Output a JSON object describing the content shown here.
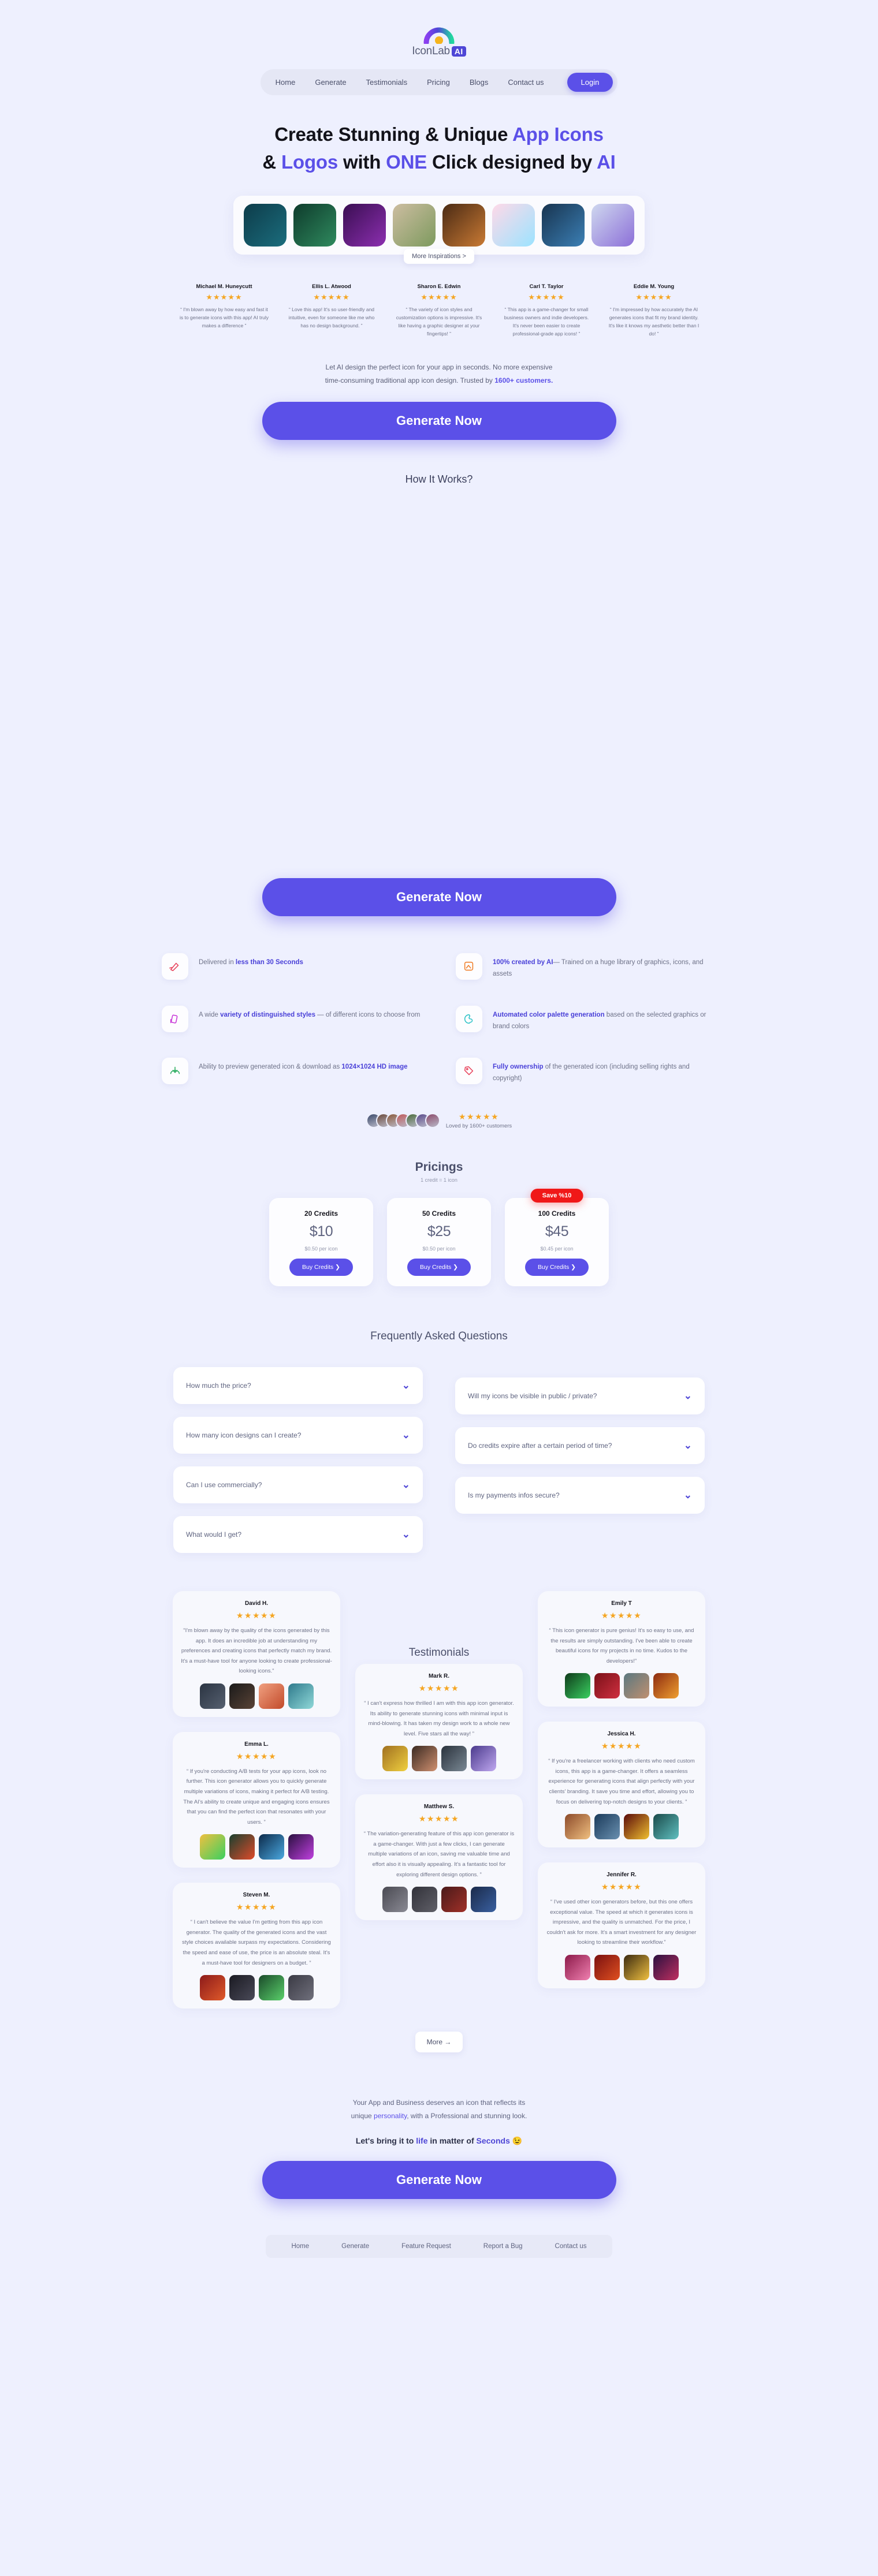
{
  "brand": {
    "name": "IconLab",
    "badge": "AI"
  },
  "nav": {
    "items": [
      {
        "label": "Home"
      },
      {
        "label": "Generate"
      },
      {
        "label": "Testimonials"
      },
      {
        "label": "Pricing"
      },
      {
        "label": "Blogs"
      },
      {
        "label": "Contact us"
      }
    ],
    "login": "Login"
  },
  "hero": {
    "line1_a": "Create Stunning & Unique ",
    "line1_b": "App Icons",
    "line2_a": "& ",
    "line2_b": "Logos",
    "line2_c": " with ",
    "line2_d": "ONE",
    "line2_e": " Click designed by ",
    "line2_f": "AI"
  },
  "strip": {
    "more_label": "More Inspirations >",
    "tiles": [
      {
        "name": "robot-icon",
        "c1": "#0d3c4a",
        "c2": "#1b6d7d"
      },
      {
        "name": "mushroom-icon",
        "c1": "#0e3b2c",
        "c2": "#2f8a5e"
      },
      {
        "name": "panther-icon",
        "c1": "#3a0e52",
        "c2": "#8c2fb0"
      },
      {
        "name": "tree-icon",
        "c1": "#cdbda1",
        "c2": "#7d9a5e"
      },
      {
        "name": "warrior-icon",
        "c1": "#4a2a14",
        "c2": "#c97a34"
      },
      {
        "name": "cat-face-icon",
        "c1": "#ffd9e8",
        "c2": "#9be3ff"
      },
      {
        "name": "car-icon",
        "c1": "#18344f",
        "c2": "#3b7fb5"
      },
      {
        "name": "unicorn-icon",
        "c1": "#cfd8ef",
        "c2": "#8c6fd8"
      }
    ]
  },
  "mini_reviews": [
    {
      "name": "Michael M. Huneycutt",
      "stars": "★★★★★",
      "text": "“ I'm blown away by how easy and fast it is to generate icons with this app! AI truly makes a difference ”"
    },
    {
      "name": "Ellis L. Atwood",
      "stars": "★★★★★",
      "text": "“ Love this app! It's so user-friendly and intuitive, even for someone like me who has no design background. ”"
    },
    {
      "name": "Sharon E. Edwin",
      "stars": "★★★★★",
      "text": "“ The variety of icon styles and customization options is impressive. It's like having a graphic designer at your fingertips! ”"
    },
    {
      "name": "Carl T. Taylor",
      "stars": "★★★★★",
      "text": "“ This app is a game-changer for small business owners and indie developers. It's never been easier to create professional-grade app icons! ”"
    },
    {
      "name": "Eddie M. Young",
      "stars": "★★★★★",
      "text": "“ I'm impressed by how accurately the AI generates icons that fit my brand identity. It's like it knows my aesthetic better than I do! ”"
    }
  ],
  "sub": {
    "line1": "Let AI design the perfect icon for your app in seconds. No more expensive",
    "line2_a": "time-consuming traditional app icon design. Trusted by ",
    "line2_b": "1600+ customers.",
    "cta": "Generate Now"
  },
  "how": {
    "title": "How It Works?"
  },
  "cta2": {
    "label": "Generate Now"
  },
  "features": [
    {
      "icon": "rocket-send-icon",
      "color": "#e8455e",
      "pre": "Delivered in ",
      "hl": "less than 30 Seconds",
      "post": ""
    },
    {
      "icon": "ai-image-icon",
      "color": "#f07f2a",
      "pre": "",
      "hl": "100% created by AI",
      "post": "— Trained on a huge library of graphics, icons, and assets"
    },
    {
      "icon": "styles-icon",
      "color": "#c838d8",
      "pre": "A wide ",
      "hl": "variety of distinguished styles",
      "post": " — of different icons to choose from"
    },
    {
      "icon": "palette-icon",
      "color": "#2fc3c8",
      "pre": "",
      "hl": "Automated color palette generation",
      "post": " based on the selected graphics or brand colors"
    },
    {
      "icon": "download-icon",
      "color": "#2fae62",
      "pre": "Ability to preview generated icon & download as ",
      "hl": "1024×1024 HD image",
      "post": ""
    },
    {
      "icon": "tag-icon",
      "color": "#e8455e",
      "pre": "",
      "hl": "Fully ownership",
      "post": " of the generated icon (including selling rights and copyright)"
    }
  ],
  "loved": {
    "stars": "★★★★★",
    "label": "Loved by 1600+ customers",
    "avatar_colors": [
      "#3b4a6b",
      "#6b4a3b",
      "#8b5a3b",
      "#c05a5a",
      "#4a6b3b",
      "#5a4a8b",
      "#8b4a6b"
    ]
  },
  "pricing": {
    "title": "Pricings",
    "note": "1 credit = 1 icon",
    "plans": [
      {
        "name": "20 Credits",
        "price": "$10",
        "per": "$0.50 per icon",
        "buy": "Buy Credits",
        "badge": ""
      },
      {
        "name": "50 Credits",
        "price": "$25",
        "per": "$0.50 per icon",
        "buy": "Buy Credits",
        "badge": ""
      },
      {
        "name": "100 Credits",
        "price": "$45",
        "per": "$0.45 per icon",
        "buy": "Buy Credits",
        "badge": "Save %10"
      }
    ]
  },
  "faq": {
    "title": "Frequently Asked Questions",
    "left": [
      {
        "q": "How much the price?"
      },
      {
        "q": "How many icon designs can I create?"
      },
      {
        "q": "Can I use commercially?"
      },
      {
        "q": "What would I get?"
      }
    ],
    "right": [
      {
        "q": "Will my icons be visible in public / private?"
      },
      {
        "q": "Do credits expire after a certain period of time?"
      },
      {
        "q": "Is my payments infos secure?"
      }
    ]
  },
  "testimonials": {
    "title": "Testimonials",
    "more": "More →",
    "left": [
      {
        "name": "David H.",
        "stars": "★★★★★",
        "text": "\"I'm blown away by the quality of the icons generated by this app. It does an incredible job at understanding my preferences and creating icons that perfectly match my brand. It's a must-have tool for anyone looking to create professional-looking icons.\"",
        "thumbs": [
          {
            "name": "gym-icon",
            "c1": "#2b3442",
            "c2": "#566070"
          },
          {
            "name": "lara-icon",
            "c1": "#1a1a1a",
            "c2": "#5a4336"
          },
          {
            "name": "bell-icon",
            "c1": "#f0a080",
            "c2": "#c24a2a"
          },
          {
            "name": "robot-book-icon",
            "c1": "#2f7a8c",
            "c2": "#8fd8d8"
          }
        ]
      },
      {
        "name": "Emma L.",
        "stars": "★★★★★",
        "text": "“ If you're conducting A/B tests for your app icons, look no further. This icon generator allows you to quickly generate multiple variations of icons, making it perfect for A/B testing. The AI's ability to create unique and engaging icons ensures that you can find the perfect icon that resonates with your users. ”",
        "thumbs": [
          {
            "name": "green-car-icon",
            "c1": "#f0c040",
            "c2": "#3ad060"
          },
          {
            "name": "red-box-icon",
            "c1": "#18402f",
            "c2": "#e04a2a"
          },
          {
            "name": "blue-light-icon",
            "c1": "#0c2a4a",
            "c2": "#4aa8e0"
          },
          {
            "name": "purple-helmet-icon",
            "c1": "#2a1040",
            "c2": "#c040e0"
          }
        ]
      },
      {
        "name": "Steven M.",
        "stars": "★★★★★",
        "text": "“ I can't believe the value I'm getting from this app icon generator. The quality of the generated icons and the vast style choices available surpass my expectations. Considering the speed and ease of use, the price is an absolute steal. It's a must-have tool for designers on a budget. ”",
        "thumbs": [
          {
            "name": "red-burger-icon",
            "c1": "#8c1a1a",
            "c2": "#e05a2a"
          },
          {
            "name": "dark-figure-icon",
            "c1": "#1a1a22",
            "c2": "#4a4a58"
          },
          {
            "name": "green-screen-icon",
            "c1": "#1a4a2a",
            "c2": "#5ad06a"
          },
          {
            "name": "grey-tile-icon",
            "c1": "#3a3a44",
            "c2": "#70707c"
          }
        ]
      }
    ],
    "mid": [
      {
        "name": "Mark R.",
        "stars": "★★★★★",
        "text": "“ I can't express how thrilled I am with this app icon generator. Its ability to generate stunning icons with minimal input is mind-blowing. It has taken my design work to a whole new level. Five stars all the way! ”",
        "thumbs": [
          {
            "name": "pikachu-icon",
            "c1": "#a07020",
            "c2": "#f0d040"
          },
          {
            "name": "brain-head-icon",
            "c1": "#3a2a22",
            "c2": "#d09070"
          },
          {
            "name": "wolf-icon",
            "c1": "#2a323c",
            "c2": "#7a8894"
          },
          {
            "name": "unicorn-icon",
            "c1": "#4a3a8c",
            "c2": "#c0a8f0"
          }
        ]
      },
      {
        "name": "Matthew S.",
        "stars": "★★★★★",
        "text": "“ The variation-generating feature of this app icon generator is a game-changer. With just a few clicks, I can generate multiple variations of an icon, saving me valuable time and effort also it is visually appealing. It's a fantastic tool for exploring different design options. ”",
        "thumbs": [
          {
            "name": "grey-robot-icon",
            "c1": "#4a4a52",
            "c2": "#8a8a94"
          },
          {
            "name": "dark-grey-icon",
            "c1": "#32323a",
            "c2": "#606068"
          },
          {
            "name": "red-dark-icon",
            "c1": "#4a1a1a",
            "c2": "#a03028"
          },
          {
            "name": "blue-dark-icon",
            "c1": "#1a2a4a",
            "c2": "#3a60a0"
          }
        ]
      }
    ],
    "right": [
      {
        "name": "Emily T",
        "stars": "★★★★★",
        "text": "“ This icon generator is pure genius! It's so easy to use, and the results are simply outstanding. I've been able to create beautiful icons for my projects in no time. Kudos to the developers!”",
        "thumbs": [
          {
            "name": "green-car-icon",
            "c1": "#0e3a1a",
            "c2": "#3ad060"
          },
          {
            "name": "spiderman-icon",
            "c1": "#7a1018",
            "c2": "#d03040"
          },
          {
            "name": "man-portrait-icon",
            "c1": "#5a7880",
            "c2": "#c09070"
          },
          {
            "name": "superman-icon",
            "c1": "#8c2a10",
            "c2": "#f0a030"
          }
        ]
      },
      {
        "name": "Jessica H.",
        "stars": "★★★★★",
        "text": "“ If you're a freelancer working with clients who need custom icons, this app is a game-changer. It offers a seamless experience for generating icons that align perfectly with your clients' branding. It save you time and effort, allowing you to focus on delivering top-notch designs to your clients. ”",
        "thumbs": [
          {
            "name": "books-icon",
            "c1": "#8c4a2a",
            "c2": "#f0c080"
          },
          {
            "name": "dog-icon",
            "c1": "#1a3a5a",
            "c2": "#6a90b0"
          },
          {
            "name": "wings-icon",
            "c1": "#5a0a0a",
            "c2": "#f0c030"
          },
          {
            "name": "puppy-icon",
            "c1": "#1a4a4a",
            "c2": "#60c0c0"
          }
        ]
      },
      {
        "name": "Jennifer R.",
        "stars": "★★★★★",
        "text": "“ I've used other icon generators before, but this one offers exceptional value. The speed at which it generates icons is impressive, and the quality is unmatched. For the price, I couldn't ask for more. It's a smart investment for any designer looking to streamline their workflow.”",
        "thumbs": [
          {
            "name": "pink-ghost-icon",
            "c1": "#8c1a4a",
            "c2": "#f080b0"
          },
          {
            "name": "red-bee-icon",
            "c1": "#7a1010",
            "c2": "#e05020"
          },
          {
            "name": "gold-ball-icon",
            "c1": "#3a2a10",
            "c2": "#f0c040"
          },
          {
            "name": "purple-streak-icon",
            "c1": "#2a1040",
            "c2": "#c03060"
          }
        ]
      }
    ]
  },
  "final": {
    "l1_a": "Your App and Business deserves an icon that reflects its",
    "l1_b": "unique ",
    "l1_c": "personality",
    "l1_d": ", with a Professional and stunning look.",
    "l2_a": "Let's bring it to ",
    "l2_b": "life",
    "l2_c": " in matter of ",
    "l2_d": "Seconds",
    "l2_e": " 😉",
    "cta": "Generate Now"
  },
  "footer": {
    "links": [
      {
        "label": "Home"
      },
      {
        "label": "Generate"
      },
      {
        "label": "Feature Request"
      },
      {
        "label": "Report a Bug"
      },
      {
        "label": "Contact us"
      }
    ]
  }
}
